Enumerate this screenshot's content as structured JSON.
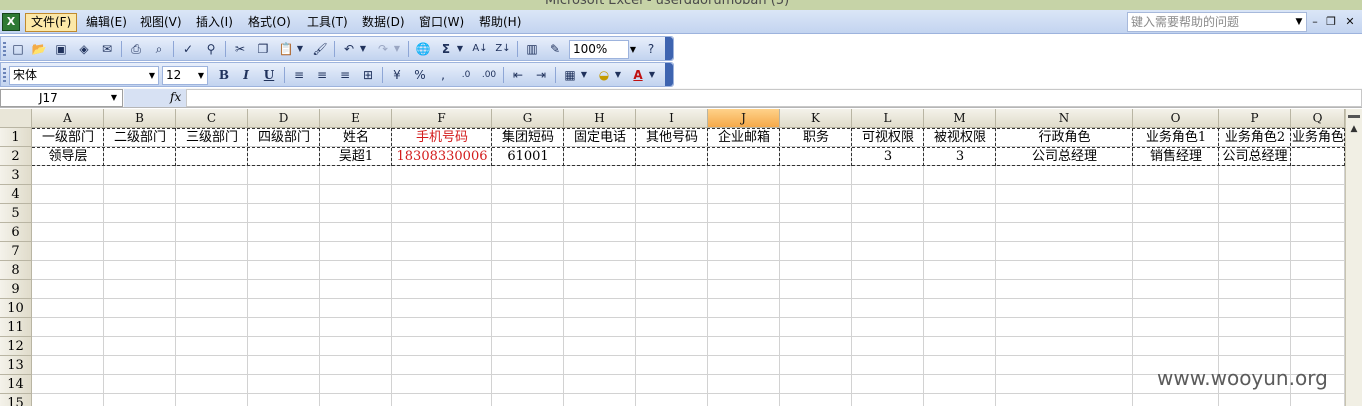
{
  "window": {
    "title": "Microsoft Excel - userdaorumoban (5)",
    "minimize_label": "–"
  },
  "menubar": {
    "app_icon_glyph": "X",
    "items": [
      {
        "label": "文件(F)",
        "active": true
      },
      {
        "label": "编辑(E)",
        "active": false
      },
      {
        "label": "视图(V)",
        "active": false
      },
      {
        "label": "插入(I)",
        "active": false
      },
      {
        "label": "格式(O)",
        "active": false
      },
      {
        "label": "工具(T)",
        "active": false
      },
      {
        "label": "数据(D)",
        "active": false
      },
      {
        "label": "窗口(W)",
        "active": false
      },
      {
        "label": "帮助(H)",
        "active": false
      }
    ],
    "help_placeholder": "键入需要帮助的问题",
    "window_buttons": {
      "minimize": "–",
      "restore": "❐",
      "close": "✕"
    }
  },
  "standard_toolbar": {
    "zoom": "100%"
  },
  "formatting_toolbar": {
    "font": "宋体",
    "font_size": "12",
    "bold": "B",
    "italic": "I",
    "underline": "U"
  },
  "formula_bar": {
    "name_box": "J17",
    "fx_label": "fx",
    "formula": ""
  },
  "sheet": {
    "selected_column": "J",
    "columns": [
      "A",
      "B",
      "C",
      "D",
      "E",
      "F",
      "G",
      "H",
      "I",
      "J",
      "K",
      "L",
      "M",
      "N",
      "O",
      "P",
      "Q"
    ],
    "rows": [
      "1",
      "2",
      "3",
      "4",
      "5",
      "6",
      "7",
      "8",
      "9",
      "10",
      "11",
      "12",
      "13",
      "14",
      "15"
    ],
    "row1": [
      "一级部门",
      "二级部门",
      "三级部门",
      "四级部门",
      "姓名",
      "手机号码",
      "集团短码",
      "固定电话",
      "其他号码",
      "企业邮箱",
      "职务",
      "可视权限",
      "被视权限",
      "行政角色",
      "业务角色1",
      "业务角色2",
      "业务角色"
    ],
    "row2": [
      "领导层",
      "",
      "",
      "",
      "吴超1",
      "18308330006",
      "61001",
      "",
      "",
      "",
      "",
      "3",
      "3",
      "公司总经理",
      "销售经理",
      "公司总经理",
      ""
    ],
    "highlight_color": "#d31c1c"
  },
  "watermark": "www.wooyun.org"
}
